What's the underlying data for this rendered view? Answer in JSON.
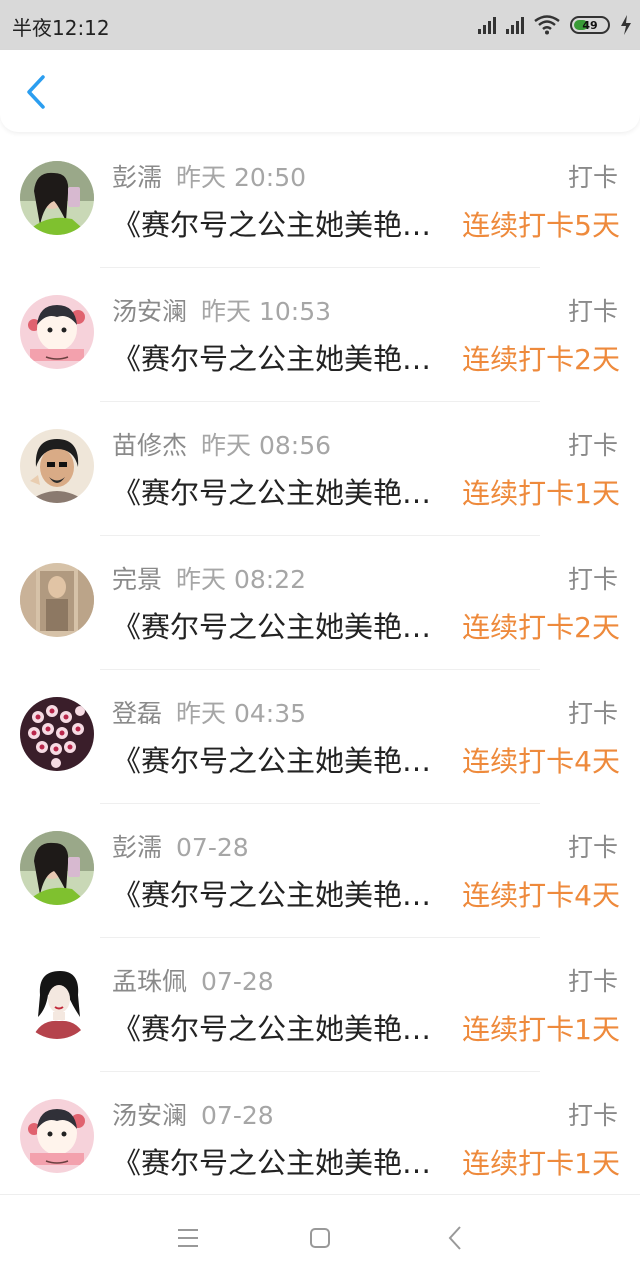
{
  "status_bar": {
    "time": "半夜12:12",
    "battery_level": 49,
    "battery_text": "49",
    "icons": [
      "signal-icon",
      "signal-icon",
      "wifi-icon",
      "battery-icon",
      "charging-icon"
    ]
  },
  "header": {
    "back_icon": "back-chevron-icon"
  },
  "colors": {
    "streak": "#ee8a3c",
    "back_accent": "#2b9ef0",
    "meta_text": "#8a8a8a",
    "status_bar_bg": "#d9d9d9"
  },
  "items": [
    {
      "name": "彭濡",
      "time": "昨天 20:50",
      "action": "打卡",
      "title": "《赛尔号之公主她美艳动人》",
      "streak": "连续打卡5天",
      "avatar": "avatar-photo-1"
    },
    {
      "name": "汤安澜",
      "time": "昨天 10:53",
      "action": "打卡",
      "title": "《赛尔号之公主她美艳动人》",
      "streak": "连续打卡2天",
      "avatar": "avatar-cartoon-1"
    },
    {
      "name": "苗修杰",
      "time": "昨天 08:56",
      "action": "打卡",
      "title": "《赛尔号之公主她美艳动人》",
      "streak": "连续打卡1天",
      "avatar": "avatar-photo-2"
    },
    {
      "name": "完景",
      "time": "昨天 08:22",
      "action": "打卡",
      "title": "《赛尔号之公主她美艳动人》",
      "streak": "连续打卡2天",
      "avatar": "avatar-photo-3"
    },
    {
      "name": "登磊",
      "time": "昨天 04:35",
      "action": "打卡",
      "title": "《赛尔号之公主她美艳动人》",
      "streak": "连续打卡4天",
      "avatar": "avatar-flowers"
    },
    {
      "name": "彭濡",
      "time": "07-28",
      "action": "打卡",
      "title": "《赛尔号之公主她美艳动人》",
      "streak": "连续打卡4天",
      "avatar": "avatar-photo-1"
    },
    {
      "name": "孟珠佩",
      "time": "07-28",
      "action": "打卡",
      "title": "《赛尔号之公主她美艳动人》",
      "streak": "连续打卡1天",
      "avatar": "avatar-illustration"
    },
    {
      "name": "汤安澜",
      "time": "07-28",
      "action": "打卡",
      "title": "《赛尔号之公主她美艳动人》",
      "streak": "连续打卡1天",
      "avatar": "avatar-cartoon-1"
    }
  ],
  "nav_bar": {
    "icons": [
      "menu-icon",
      "home-icon",
      "back-icon"
    ]
  }
}
